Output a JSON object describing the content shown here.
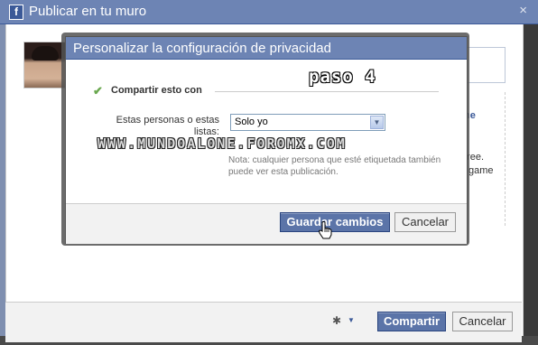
{
  "outer_dialog": {
    "title": "Publicar en tu muro",
    "close": "×",
    "bg_fragments": [
      "ne",
      "free.",
      "game",
      "."
    ],
    "share_button": "Compartir",
    "cancel_button": "Cancelar",
    "gear_icon": "gear-icon"
  },
  "privacy_modal": {
    "title": "Personalizar la configuración de privacidad",
    "check_icon": "checkmark-icon",
    "share_section_label": "Compartir esto con",
    "people_label": "Estas personas o estas listas:",
    "select_value": "Solo yo",
    "note": "Nota: cualquier persona que esté etiquetada también puede ver esta publicación.",
    "save_button": "Guardar cambios",
    "cancel_button": "Cancelar"
  },
  "overlays": {
    "step_label": "paso 4",
    "watermark": "WWW.MUNDOALONE.FOROMX.COM"
  },
  "colors": {
    "header_blue": "#6d84b4",
    "button_blue": "#5b74a8",
    "check_green": "#6aa84f"
  }
}
